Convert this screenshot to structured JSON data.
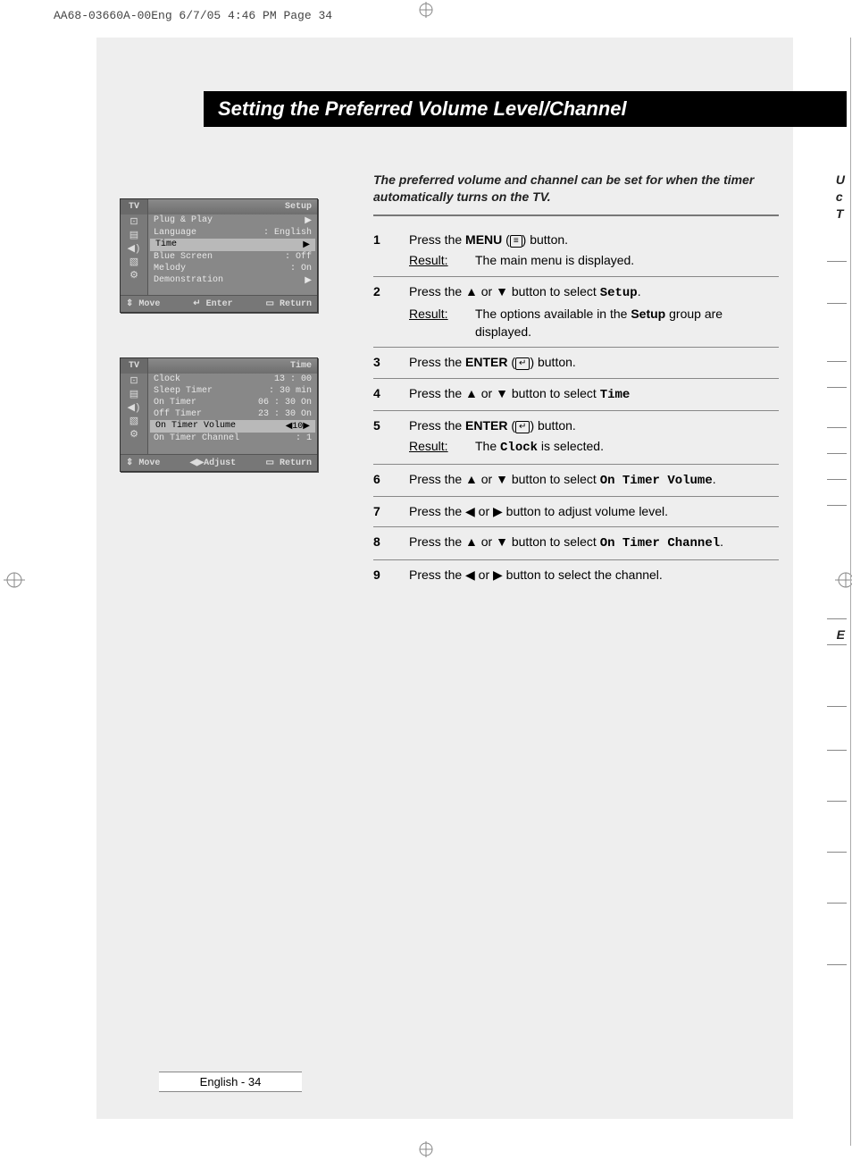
{
  "header": "AA68-03660A-00Eng  6/7/05  4:46 PM  Page 34",
  "title": "Setting the Preferred Volume Level/Channel",
  "intro": "The preferred volume and channel can be set for when the timer automatically turns on the TV.",
  "side_top_lines": [
    "U",
    "c",
    "T"
  ],
  "side_e": "E",
  "osd1": {
    "tv": "TV",
    "section": "Setup",
    "rows": [
      {
        "label": "Plug & Play",
        "value": "▶",
        "hi": false
      },
      {
        "label": "Language",
        "value": ": English",
        "hi": false
      },
      {
        "label": "Time",
        "value": "▶",
        "hi": true
      },
      {
        "label": "Blue Screen",
        "value": ": Off",
        "hi": false
      },
      {
        "label": "Melody",
        "value": ": On",
        "hi": false
      },
      {
        "label": "Demonstration",
        "value": "▶",
        "hi": false
      }
    ],
    "foot": {
      "move": "Move",
      "mid": "Enter",
      "ret": "Return"
    }
  },
  "osd2": {
    "tv": "TV",
    "section": "Time",
    "rows": [
      {
        "label": "Clock",
        "value": "13 : 00",
        "hi": false
      },
      {
        "label": "Sleep Timer",
        "value": ": 30 min",
        "hi": false
      },
      {
        "label": "On Timer",
        "value": "06 : 30 On",
        "hi": false
      },
      {
        "label": "Off Timer",
        "value": "23 : 30 On",
        "hi": false
      },
      {
        "label": "On Timer Volume",
        "value": "◀10▶",
        "hi": true
      },
      {
        "label": "On Timer Channel",
        "value": ": 1",
        "hi": false
      }
    ],
    "foot": {
      "move": "Move",
      "mid": "Adjust",
      "ret": "Return"
    }
  },
  "steps": [
    {
      "n": "1",
      "body": "Press the <b>MENU</b> (<span class='glyph-menu'>&#x2261;</span>) button.",
      "result": "The main menu is displayed."
    },
    {
      "n": "2",
      "body": "Press the ▲ or ▼ button to select <span class='mono'>Setup</span>.",
      "result": "The options available in the <b>Setup</b> group are displayed."
    },
    {
      "n": "3",
      "body": "Press the <b>ENTER</b> (<span class='glyph-enter'>↵</span>) button."
    },
    {
      "n": "4",
      "body": "Press the ▲ or ▼ button to select <span class='mono'>Time</span>"
    },
    {
      "n": "5",
      "body": "Press the <b>ENTER</b> (<span class='glyph-enter'>↵</span>) button.",
      "result": "The <span class='mono'>Clock</span> is selected."
    },
    {
      "n": "6",
      "body": "Press the ▲ or ▼ button to select <span class='mono'>On Timer Volume</span>."
    },
    {
      "n": "7",
      "body": "Press the ◀ or ▶ button to adjust volume level."
    },
    {
      "n": "8",
      "body": "Press the ▲ or ▼ button to select <span class='mono'>On Timer Channel</span>."
    },
    {
      "n": "9",
      "body": "Press the ◀ or ▶ button to select the channel."
    }
  ],
  "result_label": "Result:",
  "page_number": "English - 34",
  "foot_mid_prefix": {
    "osd1": "↵ ",
    "osd2": "◀▶"
  },
  "foot_move_prefix": "⇕ ",
  "foot_ret_prefix": "▭ "
}
